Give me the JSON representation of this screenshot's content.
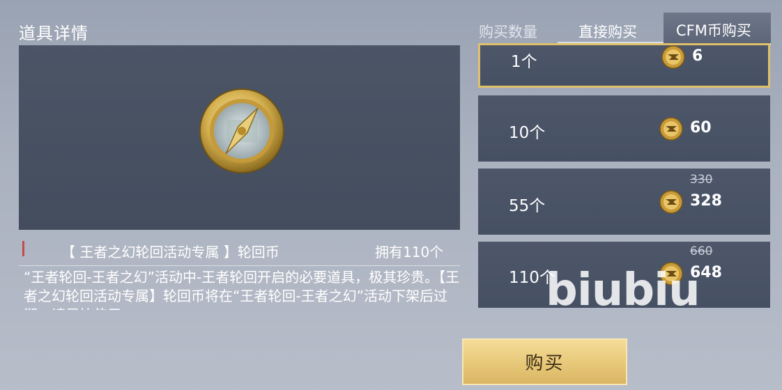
{
  "header": {
    "title": "道具详情"
  },
  "tabs": {
    "quantity_label": "购买数量",
    "direct_label": "直接购买",
    "cfm_label": "CFM币购买"
  },
  "item": {
    "name": "【 王者之幻轮回活动专属 】轮回币",
    "owned": "拥有110个",
    "description": "“王者轮回-王者之幻”活动中-王者轮回开启的必要道具，极其珍贵。【王者之幻轮回活动专属】轮回币将在“王者轮回-王者之幻”活动下架后过期，请尽快使用"
  },
  "options": [
    {
      "qty": "1个",
      "price": "6",
      "original": "",
      "selected": true
    },
    {
      "qty": "10个",
      "price": "60",
      "original": "",
      "selected": false
    },
    {
      "qty": "55个",
      "price": "328",
      "original": "330",
      "selected": false
    },
    {
      "qty": "110个",
      "price": "648",
      "original": "660",
      "selected": false
    }
  ],
  "buy_button": {
    "label": "购买"
  },
  "watermark": {
    "text": "biubiu"
  },
  "colors": {
    "gold_accent": "#e0c06a",
    "panel": "#4b5566",
    "buy_button": "#e7c879"
  },
  "icons": {
    "currency": "cfm-coin-icon",
    "item": "compass-coin-icon"
  }
}
